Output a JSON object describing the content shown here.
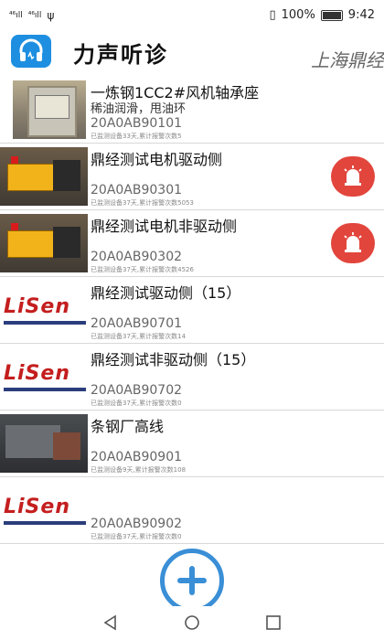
{
  "status_bar": {
    "signal_1": "⁴⁶ıll",
    "signal_2": "⁴⁶ıll",
    "usb": "ψ",
    "battery_percent": "100%",
    "time": "9:42"
  },
  "app": {
    "title": "力声听诊",
    "company": "上海鼎经",
    "logo_icon": "headphones-icon"
  },
  "devices": [
    {
      "name": "一炼钢1CC2#风机轴承座",
      "sub": "稀油润滑，甩油环",
      "code": "20A0AB90101",
      "meta": "已监测设备33天,累计报警次数5",
      "alarm": false
    },
    {
      "name": "鼎经测试电机驱动侧",
      "sub": "",
      "code": "20A0AB90301",
      "meta": "已监测设备37天,累计报警次数5053",
      "alarm": true
    },
    {
      "name": "鼎经测试电机非驱动侧",
      "sub": "",
      "code": "20A0AB90302",
      "meta": "已监测设备37天,累计报警次数4526",
      "alarm": true
    },
    {
      "name": "鼎经测试驱动侧（15）",
      "sub": "",
      "code": "20A0AB90701",
      "meta": "已监测设备37天,累计报警次数14",
      "alarm": false
    },
    {
      "name": "鼎经测试非驱动侧（15）",
      "sub": "",
      "code": "20A0AB90702",
      "meta": "已监测设备37天,累计报警次数0",
      "alarm": false
    },
    {
      "name": "条钢厂高线",
      "sub": "",
      "code": "20A0AB90901",
      "meta": "已监测设备9天,累计报警次数108",
      "alarm": false
    },
    {
      "name": "",
      "sub": "",
      "code": "20A0AB90902",
      "meta": "已监测设备37天,累计报警次数0",
      "alarm": false
    }
  ],
  "brand_logo_text": "LiSen",
  "fab": {
    "icon": "plus-icon"
  },
  "colors": {
    "accent": "#3a8fd6",
    "alarm": "#e2453c",
    "logo_bg": "#1e8fe0",
    "brand_red": "#c41e1e"
  }
}
